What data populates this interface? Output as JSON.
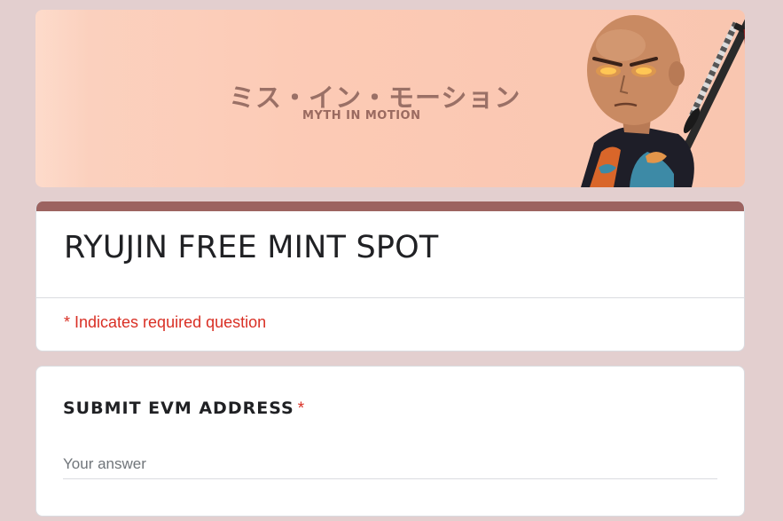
{
  "banner": {
    "jp_title": "ミス・イン・モーション",
    "en_title": "MYTH IN MOTION",
    "illustration": "samurai-character-with-katana"
  },
  "form": {
    "title": "RYUJIN FREE MINT SPOT",
    "required_note": "* Indicates required question",
    "accent_color": "#9c6360",
    "required_color": "#d93025"
  },
  "question": {
    "label": "SUBMIT EVM ADDRESS",
    "required_mark": "*",
    "placeholder": "Your answer",
    "value": ""
  }
}
